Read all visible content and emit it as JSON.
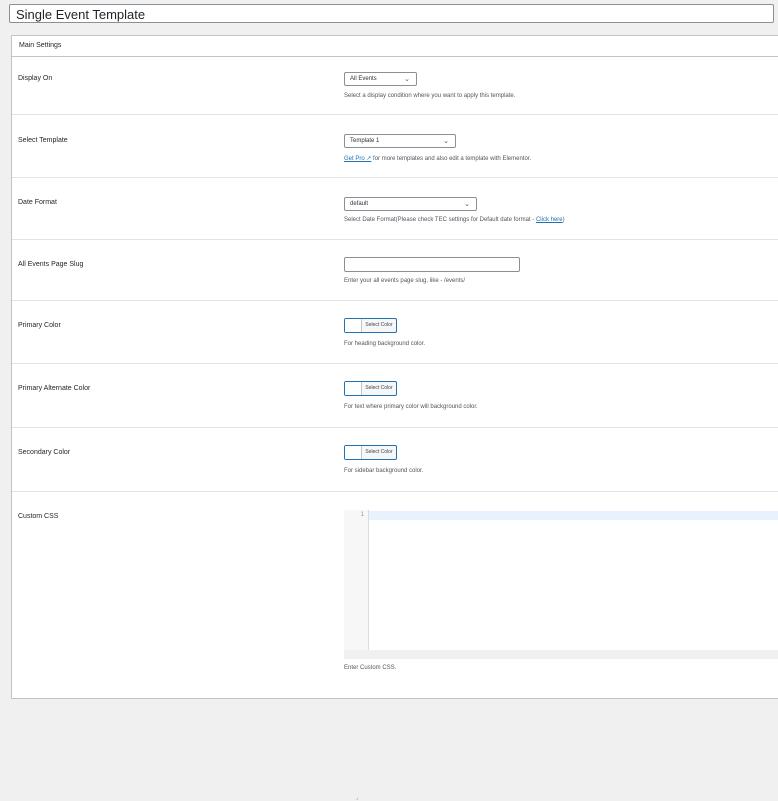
{
  "post_title": "Single Event Template",
  "panel": {
    "title": "Main Settings"
  },
  "display_on": {
    "label": "Display On",
    "value": "All Events",
    "description": "Select a display condition where you want to apply this template."
  },
  "select_template": {
    "label": "Select Template",
    "value": "Template 1",
    "link_text": "Get Pro ↗",
    "description_rest": " for more templates and also edit a template with Elementor."
  },
  "date_format": {
    "label": "Date Format",
    "value": "default",
    "description": "Select Date Format(Please check TEC settings for Default date format - ",
    "link_text": "Click here",
    "description_end": ")"
  },
  "events_slug": {
    "label": "All Events Page Slug",
    "value": "",
    "description": "Enter your all events page slug, like - /events/"
  },
  "primary_color": {
    "label": "Primary Color",
    "button_label": "Select Color",
    "description": "For heading background color."
  },
  "primary_alt_color": {
    "label": "Primary Alternate Color",
    "button_label": "Select Color",
    "description": "For text where primary color will background color."
  },
  "secondary_color": {
    "label": "Secondary Color",
    "button_label": "Select Color",
    "description": "For sidebar background color."
  },
  "custom_css": {
    "label": "Custom CSS",
    "line_number": "1",
    "value": "",
    "description": "Enter Custom CSS."
  }
}
